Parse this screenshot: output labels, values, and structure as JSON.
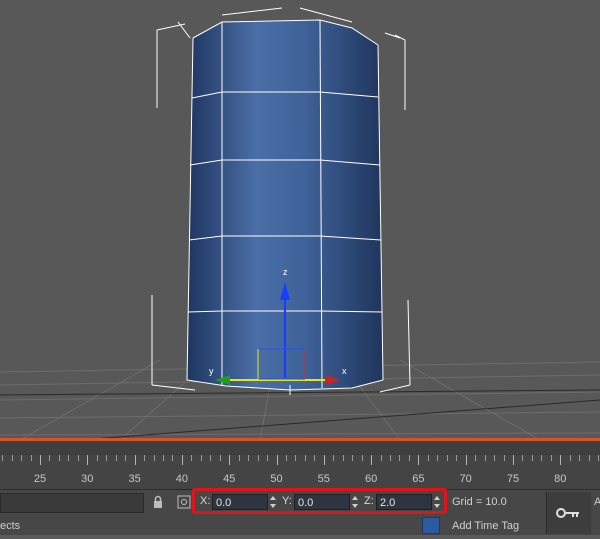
{
  "viewport": {
    "axis_z": "z",
    "axis_x": "x",
    "axis_y": "y"
  },
  "timeline": {
    "ticks": [
      "25",
      "30",
      "35",
      "40",
      "45",
      "50",
      "55",
      "60",
      "65",
      "70",
      "75",
      "80"
    ]
  },
  "statusbar": {
    "status_text": "ects",
    "x_label": "X:",
    "x_value": "0.0",
    "y_label": "Y:",
    "y_value": "0.0",
    "z_label": "Z:",
    "z_value": "2.0",
    "grid_text": "Grid = 10.0",
    "time_tag": "Add Time Tag",
    "trailing_letter": "A"
  },
  "colors": {
    "highlight": "#e0131b",
    "timeline_accent": "#d8532a",
    "object_blue": "#3a5a8c"
  }
}
